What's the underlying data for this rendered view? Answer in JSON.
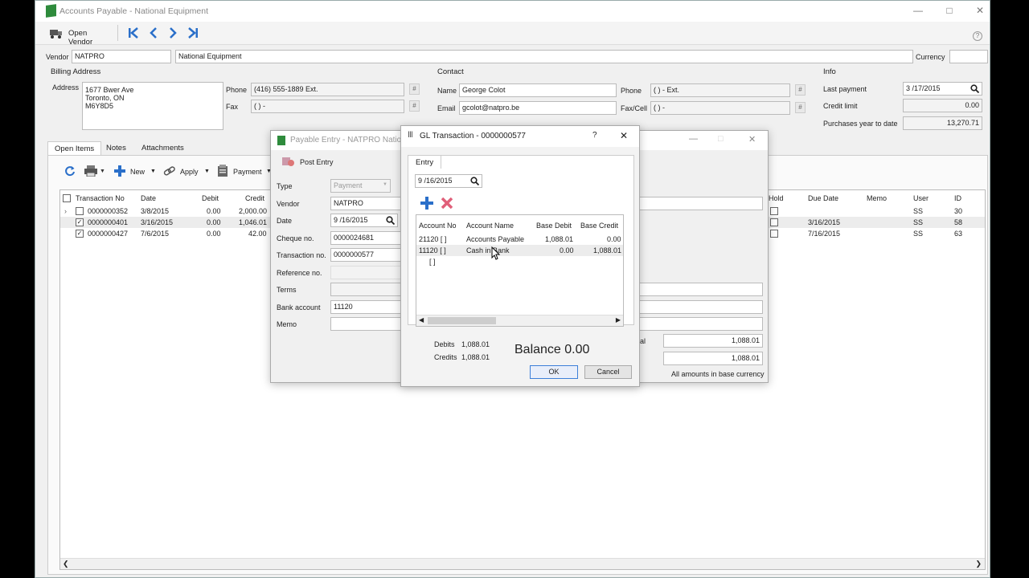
{
  "window": {
    "title": "Accounts Payable - National Equipment"
  },
  "toolbar": {
    "open_vendor": "Open Vendor"
  },
  "header": {
    "vendor_label": "Vendor",
    "vendor_code": "NATPRO",
    "vendor_name": "National Equipment",
    "currency_label": "Currency",
    "currency_value": ""
  },
  "billing": {
    "section": "Billing Address",
    "address_label": "Address",
    "address_lines": [
      "1677 Bwer Ave",
      "Toronto, ON",
      "M6Y8D5"
    ],
    "phone_label": "Phone",
    "phone": "(416) 555-1889 Ext.",
    "fax_label": "Fax",
    "fax": "(  )     -"
  },
  "contact": {
    "section": "Contact",
    "name_label": "Name",
    "name": "George Colot",
    "email_label": "Email",
    "email": "gcolot@natpro.be",
    "phone_label": "Phone",
    "phone": "(  )     -        Ext.",
    "faxcell_label": "Fax/Cell",
    "faxcell": "(  )     -"
  },
  "info": {
    "section": "Info",
    "last_payment_label": "Last payment",
    "last_payment": "3 /17/2015",
    "credit_limit_label": "Credit limit",
    "credit_limit": "0.00",
    "purchases_ytd_label": "Purchases year to date",
    "purchases_ytd": "13,270.71"
  },
  "tabs": [
    "Open Items",
    "Notes",
    "Attachments"
  ],
  "items_toolbar": {
    "new": "New",
    "apply": "Apply",
    "payment": "Payment"
  },
  "open_items": {
    "columns": [
      "Transaction No",
      "Date",
      "Debit",
      "Credit"
    ],
    "right_columns": [
      "Hold",
      "Due Date",
      "Memo",
      "User",
      "ID"
    ],
    "rows": [
      {
        "txn": "0000000352",
        "date": "3/8/2015",
        "debit": "0.00",
        "credit": "2,000.00",
        "due": "",
        "user": "SS",
        "id": "30"
      },
      {
        "txn": "0000000401",
        "date": "3/16/2015",
        "debit": "0.00",
        "credit": "1,046.01",
        "due": "3/16/2015",
        "user": "SS",
        "id": "58"
      },
      {
        "txn": "0000000427",
        "date": "7/6/2015",
        "debit": "0.00",
        "credit": "42.00",
        "due": "7/16/2015",
        "user": "SS",
        "id": "63"
      }
    ]
  },
  "payable_entry": {
    "title": "Payable Entry - NATPRO Nation",
    "post_entry": "Post Entry",
    "type_label": "Type",
    "type_value": "Payment",
    "vendor_label": "Vendor",
    "vendor_value": "NATPRO",
    "date_label": "Date",
    "date_value": "9 /16/2015",
    "cheque_label": "Cheque no.",
    "cheque_value": "0000024681",
    "txn_label": "Transaction no.",
    "txn_value": "0000000577",
    "ref_label": "Reference no.",
    "terms_label": "Terms",
    "bank_label": "Bank account",
    "bank_value": "11120",
    "memo_label": "Memo",
    "total_label": "al",
    "total1": "1,088.01",
    "total2": "1,088.01",
    "base_currency_note": "All amounts in base currency"
  },
  "gl_dialog": {
    "title": "GL Transaction - 0000000577",
    "help": "?",
    "tab": "Entry",
    "date": "9 /16/2015",
    "columns": [
      "Account No",
      "Account Name",
      "Base Debit",
      "Base Credit"
    ],
    "rows": [
      {
        "acct": "21120 [  ]",
        "name": "Accounts Payable",
        "debit": "1,088.01",
        "credit": "0.00"
      },
      {
        "acct": "11120 [  ]",
        "name": "Cash in Bank",
        "debit": "0.00",
        "credit": "1,088.01"
      },
      {
        "acct": "[  ]",
        "name": "",
        "debit": "",
        "credit": ""
      }
    ],
    "debits_label": "Debits",
    "debits": "1,088.01",
    "credits_label": "Credits",
    "credits": "1,088.01",
    "balance": "Balance 0.00",
    "ok": "OK",
    "cancel": "Cancel"
  },
  "colors": {
    "accent_blue": "#2a6fc9",
    "delete_pink": "#e0607a",
    "brand_green": "#2e8b3c"
  }
}
